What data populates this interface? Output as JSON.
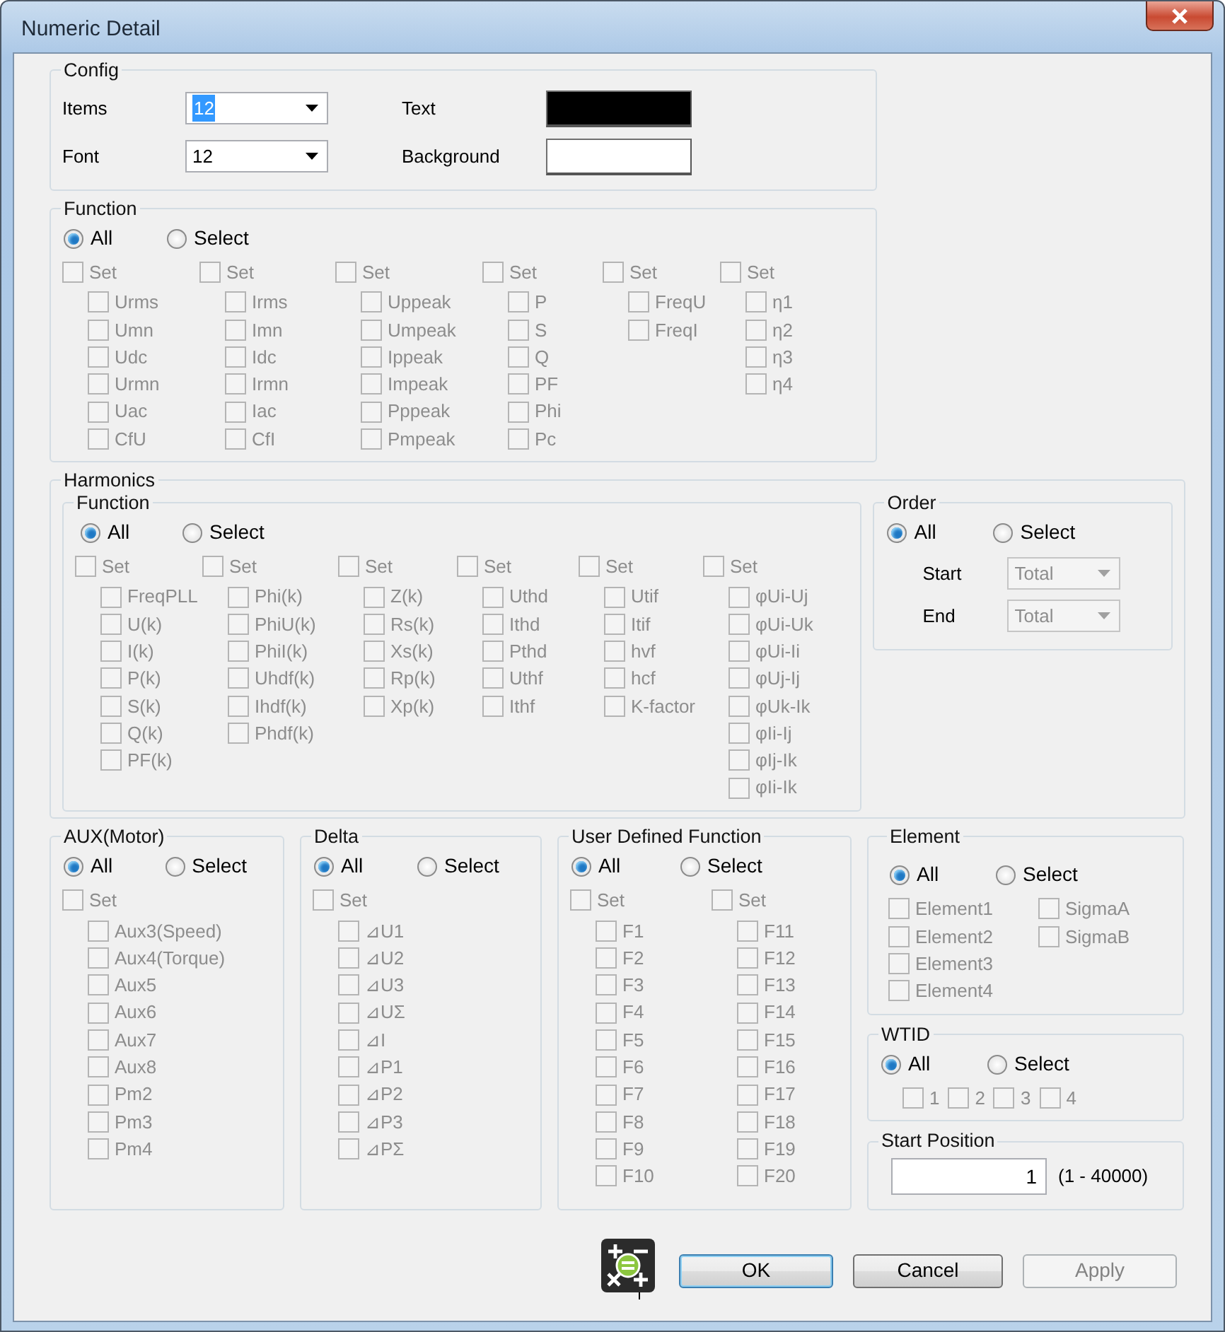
{
  "window": {
    "title": "Numeric Detail"
  },
  "config": {
    "title": "Config",
    "items": {
      "label": "Items",
      "value": "12",
      "text_selected": true
    },
    "font": {
      "label": "Font",
      "value": "12",
      "text_selected": false
    },
    "text_color": {
      "label": "Text",
      "color": "#000000"
    },
    "background_color": {
      "label": "Background",
      "color": "#ffffff"
    }
  },
  "function": {
    "title": "Function",
    "items_disabled": true,
    "radios": [
      {
        "label": "All",
        "selected": true
      },
      {
        "label": "Select",
        "selected": false
      }
    ],
    "columns": [
      {
        "set": {
          "label": "Set",
          "checked": false
        },
        "items": [
          {
            "label": "Urms",
            "checked": false
          },
          {
            "label": "Umn",
            "checked": false
          },
          {
            "label": "Udc",
            "checked": false
          },
          {
            "label": "Urmn",
            "checked": false
          },
          {
            "label": "Uac",
            "checked": false
          },
          {
            "label": "CfU",
            "checked": false
          }
        ]
      },
      {
        "set": {
          "label": "Set",
          "checked": false
        },
        "items": [
          {
            "label": "Irms",
            "checked": false
          },
          {
            "label": "Imn",
            "checked": false
          },
          {
            "label": "Idc",
            "checked": false
          },
          {
            "label": "Irmn",
            "checked": false
          },
          {
            "label": "Iac",
            "checked": false
          },
          {
            "label": "CfI",
            "checked": false
          }
        ]
      },
      {
        "set": {
          "label": "Set",
          "checked": false
        },
        "items": [
          {
            "label": "Uppeak",
            "checked": false
          },
          {
            "label": "Umpeak",
            "checked": false
          },
          {
            "label": "Ippeak",
            "checked": false
          },
          {
            "label": "Impeak",
            "checked": false
          },
          {
            "label": "Pppeak",
            "checked": false
          },
          {
            "label": "Pmpeak",
            "checked": false
          }
        ]
      },
      {
        "set": {
          "label": "Set",
          "checked": false
        },
        "items": [
          {
            "label": "P",
            "checked": false
          },
          {
            "label": "S",
            "checked": false
          },
          {
            "label": "Q",
            "checked": false
          },
          {
            "label": "PF",
            "checked": false
          },
          {
            "label": "Phi",
            "checked": false
          },
          {
            "label": "Pc",
            "checked": false
          }
        ]
      },
      {
        "set": {
          "label": "Set",
          "checked": false
        },
        "items": [
          {
            "label": "FreqU",
            "checked": false
          },
          {
            "label": "FreqI",
            "checked": false
          }
        ]
      },
      {
        "set": {
          "label": "Set",
          "checked": false
        },
        "items": [
          {
            "label": "η1",
            "checked": false
          },
          {
            "label": "η2",
            "checked": false
          },
          {
            "label": "η3",
            "checked": false
          },
          {
            "label": "η4",
            "checked": false
          }
        ]
      }
    ]
  },
  "harmonics": {
    "title": "Harmonics",
    "function": {
      "title": "Function",
      "items_disabled": true,
      "radios": [
        {
          "label": "All",
          "selected": true
        },
        {
          "label": "Select",
          "selected": false
        }
      ],
      "columns": [
        {
          "set": {
            "label": "Set",
            "checked": false
          },
          "items": [
            {
              "label": "FreqPLL",
              "checked": false
            },
            {
              "label": "U(k)",
              "checked": false
            },
            {
              "label": "I(k)",
              "checked": false
            },
            {
              "label": "P(k)",
              "checked": false
            },
            {
              "label": "S(k)",
              "checked": false
            },
            {
              "label": "Q(k)",
              "checked": false
            },
            {
              "label": "PF(k)",
              "checked": false
            }
          ]
        },
        {
          "set": {
            "label": "Set",
            "checked": false
          },
          "items": [
            {
              "label": "Phi(k)",
              "checked": false
            },
            {
              "label": "PhiU(k)",
              "checked": false
            },
            {
              "label": "PhiI(k)",
              "checked": false
            },
            {
              "label": "Uhdf(k)",
              "checked": false
            },
            {
              "label": "Ihdf(k)",
              "checked": false
            },
            {
              "label": "Phdf(k)",
              "checked": false
            }
          ]
        },
        {
          "set": {
            "label": "Set",
            "checked": false
          },
          "items": [
            {
              "label": "Z(k)",
              "checked": false
            },
            {
              "label": "Rs(k)",
              "checked": false
            },
            {
              "label": "Xs(k)",
              "checked": false
            },
            {
              "label": "Rp(k)",
              "checked": false
            },
            {
              "label": "Xp(k)",
              "checked": false
            }
          ]
        },
        {
          "set": {
            "label": "Set",
            "checked": false
          },
          "items": [
            {
              "label": "Uthd",
              "checked": false
            },
            {
              "label": "Ithd",
              "checked": false
            },
            {
              "label": "Pthd",
              "checked": false
            },
            {
              "label": "Uthf",
              "checked": false
            },
            {
              "label": "Ithf",
              "checked": false
            }
          ]
        },
        {
          "set": {
            "label": "Set",
            "checked": false
          },
          "items": [
            {
              "label": "Utif",
              "checked": false
            },
            {
              "label": "Itif",
              "checked": false
            },
            {
              "label": "hvf",
              "checked": false
            },
            {
              "label": "hcf",
              "checked": false
            },
            {
              "label": "K-factor",
              "checked": false
            }
          ]
        },
        {
          "set": {
            "label": "Set",
            "checked": false
          },
          "items": [
            {
              "label": "φUi-Uj",
              "checked": false
            },
            {
              "label": "φUi-Uk",
              "checked": false
            },
            {
              "label": "φUi-Ii",
              "checked": false
            },
            {
              "label": "φUj-Ij",
              "checked": false
            },
            {
              "label": "φUk-Ik",
              "checked": false
            },
            {
              "label": "φIi-Ij",
              "checked": false
            },
            {
              "label": "φIj-Ik",
              "checked": false
            },
            {
              "label": "φIi-Ik",
              "checked": false
            }
          ]
        }
      ]
    },
    "order": {
      "title": "Order",
      "fields_disabled": true,
      "radios": [
        {
          "label": "All",
          "selected": true
        },
        {
          "label": "Select",
          "selected": false
        }
      ],
      "start": {
        "label": "Start",
        "value": "Total"
      },
      "end": {
        "label": "End",
        "value": "Total"
      }
    }
  },
  "aux": {
    "title": "AUX(Motor)",
    "items_disabled": true,
    "radios": [
      {
        "label": "All",
        "selected": true
      },
      {
        "label": "Select",
        "selected": false
      }
    ],
    "columns": [
      {
        "set": {
          "label": "Set",
          "checked": false
        },
        "items": [
          {
            "label": "Aux3(Speed)",
            "checked": false
          },
          {
            "label": "Aux4(Torque)",
            "checked": false
          },
          {
            "label": "Aux5",
            "checked": false
          },
          {
            "label": "Aux6",
            "checked": false
          },
          {
            "label": "Aux7",
            "checked": false
          },
          {
            "label": "Aux8",
            "checked": false
          },
          {
            "label": "Pm2",
            "checked": false
          },
          {
            "label": "Pm3",
            "checked": false
          },
          {
            "label": "Pm4",
            "checked": false
          }
        ]
      }
    ]
  },
  "delta": {
    "title": "Delta",
    "items_disabled": true,
    "radios": [
      {
        "label": "All",
        "selected": true
      },
      {
        "label": "Select",
        "selected": false
      }
    ],
    "columns": [
      {
        "set": {
          "label": "Set",
          "checked": false
        },
        "items": [
          {
            "label": "⊿U1",
            "checked": false
          },
          {
            "label": "⊿U2",
            "checked": false
          },
          {
            "label": "⊿U3",
            "checked": false
          },
          {
            "label": "⊿UΣ",
            "checked": false
          },
          {
            "label": "⊿I",
            "checked": false
          },
          {
            "label": "⊿P1",
            "checked": false
          },
          {
            "label": "⊿P2",
            "checked": false
          },
          {
            "label": "⊿P3",
            "checked": false
          },
          {
            "label": "⊿PΣ",
            "checked": false
          }
        ]
      }
    ]
  },
  "user_defined_function": {
    "title": "User Defined Function",
    "items_disabled": true,
    "radios": [
      {
        "label": "All",
        "selected": true
      },
      {
        "label": "Select",
        "selected": false
      }
    ],
    "columns": [
      {
        "set": {
          "label": "Set",
          "checked": false
        },
        "items": [
          {
            "label": "F1",
            "checked": false
          },
          {
            "label": "F2",
            "checked": false
          },
          {
            "label": "F3",
            "checked": false
          },
          {
            "label": "F4",
            "checked": false
          },
          {
            "label": "F5",
            "checked": false
          },
          {
            "label": "F6",
            "checked": false
          },
          {
            "label": "F7",
            "checked": false
          },
          {
            "label": "F8",
            "checked": false
          },
          {
            "label": "F9",
            "checked": false
          },
          {
            "label": "F10",
            "checked": false
          }
        ]
      },
      {
        "set": {
          "label": "Set",
          "checked": false
        },
        "items": [
          {
            "label": "F11",
            "checked": false
          },
          {
            "label": "F12",
            "checked": false
          },
          {
            "label": "F13",
            "checked": false
          },
          {
            "label": "F14",
            "checked": false
          },
          {
            "label": "F15",
            "checked": false
          },
          {
            "label": "F16",
            "checked": false
          },
          {
            "label": "F17",
            "checked": false
          },
          {
            "label": "F18",
            "checked": false
          },
          {
            "label": "F19",
            "checked": false
          },
          {
            "label": "F20",
            "checked": false
          }
        ]
      }
    ]
  },
  "element": {
    "title": "Element",
    "items_disabled": true,
    "radios": [
      {
        "label": "All",
        "selected": true
      },
      {
        "label": "Select",
        "selected": false
      }
    ],
    "columns": [
      {
        "items": [
          {
            "label": "Element1",
            "checked": false
          },
          {
            "label": "Element2",
            "checked": false
          },
          {
            "label": "Element3",
            "checked": false
          },
          {
            "label": "Element4",
            "checked": false
          }
        ]
      },
      {
        "items": [
          {
            "label": "SigmaA",
            "checked": false
          },
          {
            "label": "SigmaB",
            "checked": false
          }
        ]
      }
    ]
  },
  "wtid": {
    "title": "WTID",
    "items_disabled": true,
    "radios": [
      {
        "label": "All",
        "selected": true
      },
      {
        "label": "Select",
        "selected": false
      }
    ],
    "items": [
      {
        "label": "1",
        "checked": false
      },
      {
        "label": "2",
        "checked": false
      },
      {
        "label": "3",
        "checked": false
      },
      {
        "label": "4",
        "checked": false
      }
    ]
  },
  "start_position": {
    "title": "Start Position",
    "value": "1",
    "range": "(1 - 40000)"
  },
  "buttons": [
    {
      "label": "OK",
      "default": true,
      "disabled": false
    },
    {
      "label": "Cancel",
      "default": false,
      "disabled": false
    },
    {
      "label": "Apply",
      "default": false,
      "disabled": true
    }
  ]
}
